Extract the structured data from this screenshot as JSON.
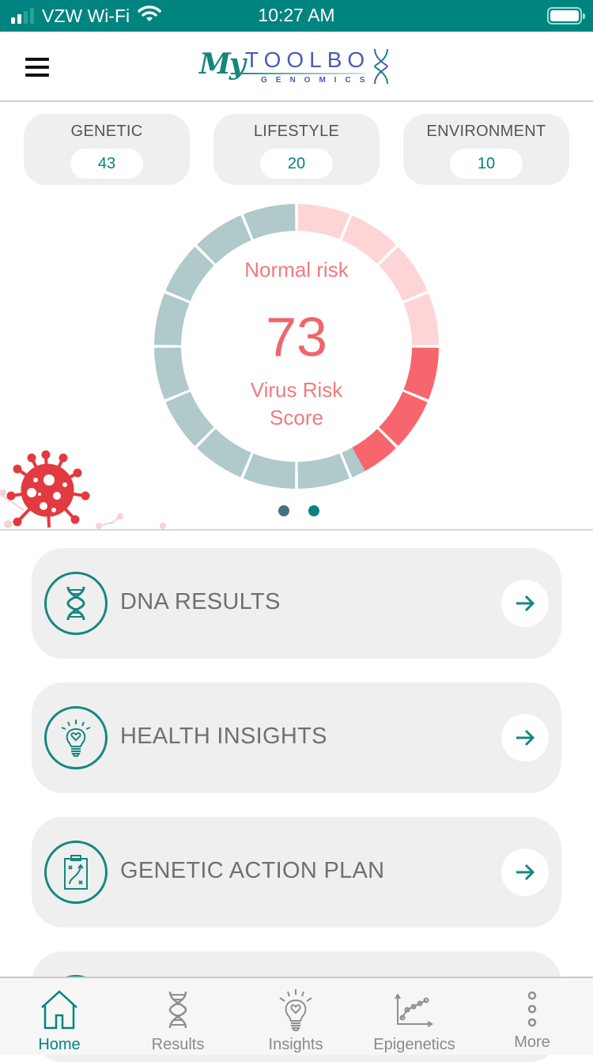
{
  "status_bar": {
    "carrier": "VZW Wi-Fi",
    "time": "10:27 AM",
    "signal_bars_active": 2,
    "signal_bars_total": 4,
    "wifi_icon": "wifi-icon",
    "battery_icon": "battery-full-icon"
  },
  "header": {
    "menu_icon": "hamburger-menu-icon",
    "logo": {
      "my": "My",
      "toolbox": "TOOLBO",
      "genomics": "GENOMICS"
    }
  },
  "stats": [
    {
      "label": "GENETIC",
      "value": "43"
    },
    {
      "label": "LIFESTYLE",
      "value": "20"
    },
    {
      "label": "ENVIRONMENT",
      "value": "10"
    }
  ],
  "gauge": {
    "caption": "Normal risk",
    "score": "73",
    "label_line1": "Virus Risk",
    "label_line2": "Score",
    "segments": 16,
    "light_fraction": 0.25,
    "red_fraction": 0.17,
    "colors": {
      "grey": "#b0c9cb",
      "light": "#fdd5d7",
      "red": "#f7666d"
    }
  },
  "carousel": {
    "pages": 2,
    "active_page": 2,
    "dot_colors": [
      "#45707f",
      "#00847f"
    ]
  },
  "menu": [
    {
      "label": "DNA RESULTS",
      "icon": "dna-icon"
    },
    {
      "label": "HEALTH INSIGHTS",
      "icon": "lightbulb-heart-icon"
    },
    {
      "label": "GENETIC ACTION PLAN",
      "icon": "clipboard-plan-icon"
    }
  ],
  "tabbar": {
    "active": "Home",
    "tabs": [
      {
        "label": "Home",
        "icon": "home-icon"
      },
      {
        "label": "Results",
        "icon": "dna-icon"
      },
      {
        "label": "Insights",
        "icon": "lightbulb-icon"
      },
      {
        "label": "Epigenetics",
        "icon": "chart-icon"
      },
      {
        "label": "More",
        "icon": "more-dots-icon"
      }
    ]
  },
  "colors": {
    "brand": "#00847f",
    "accent_red": "#f0656b"
  }
}
